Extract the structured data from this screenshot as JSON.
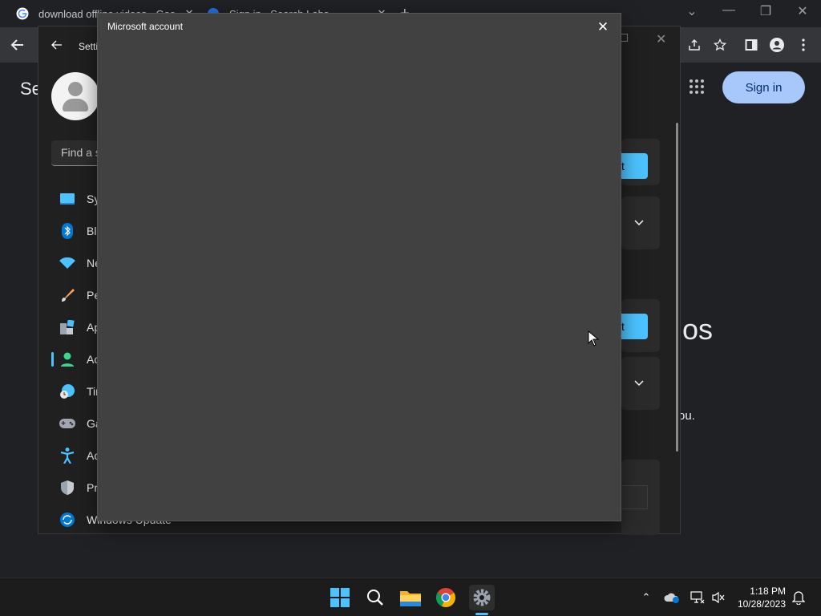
{
  "browser": {
    "tabs": [
      {
        "title": "download offline videos - Goo...",
        "favicon": "google-g-icon"
      },
      {
        "title": "Sign in - Search Labs",
        "favicon": "google-account-icon"
      }
    ],
    "new_tab_glyph": "+",
    "window_controls": {
      "tab_search": "⌄",
      "minimize": "—",
      "restore": "❐",
      "close": "✕"
    },
    "page": {
      "title_peek": "Se",
      "signin_label": "Sign in",
      "big_text_peek": "os",
      "small_text_peek": "ou."
    }
  },
  "settings": {
    "window_title_peek": "Setti",
    "search_placeholder": "Find a s",
    "nav": [
      {
        "label": "Sy",
        "icon": "system-icon"
      },
      {
        "label": "Blu",
        "icon": "bluetooth-icon"
      },
      {
        "label": "Ne",
        "icon": "network-icon"
      },
      {
        "label": "Pe",
        "icon": "personalization-icon"
      },
      {
        "label": "Ap",
        "icon": "apps-icon"
      },
      {
        "label": "Ac",
        "icon": "accounts-icon",
        "active": true
      },
      {
        "label": "Tin",
        "icon": "time-language-icon"
      },
      {
        "label": "Ga",
        "icon": "gaming-icon"
      },
      {
        "label": "Ac",
        "icon": "accessibility-icon"
      },
      {
        "label": "Pr",
        "icon": "privacy-icon"
      },
      {
        "label": "Windows Update",
        "icon": "windows-update-icon"
      }
    ],
    "card_button_peek": "t"
  },
  "dialog": {
    "title": "Microsoft account",
    "close_glyph": "✕"
  },
  "taskbar": {
    "apps": [
      "start-icon",
      "search-icon",
      "file-explorer-icon",
      "chrome-icon",
      "settings-icon"
    ],
    "tray": {
      "overflow_glyph": "⌃"
    },
    "clock": {
      "time": "1:18 PM",
      "date": "10/28/2023"
    }
  },
  "colors": {
    "accent": "#4cc2ff",
    "dialog_bg": "#414141",
    "settings_bg": "#202020",
    "signin_bg": "#a8c7fa"
  }
}
